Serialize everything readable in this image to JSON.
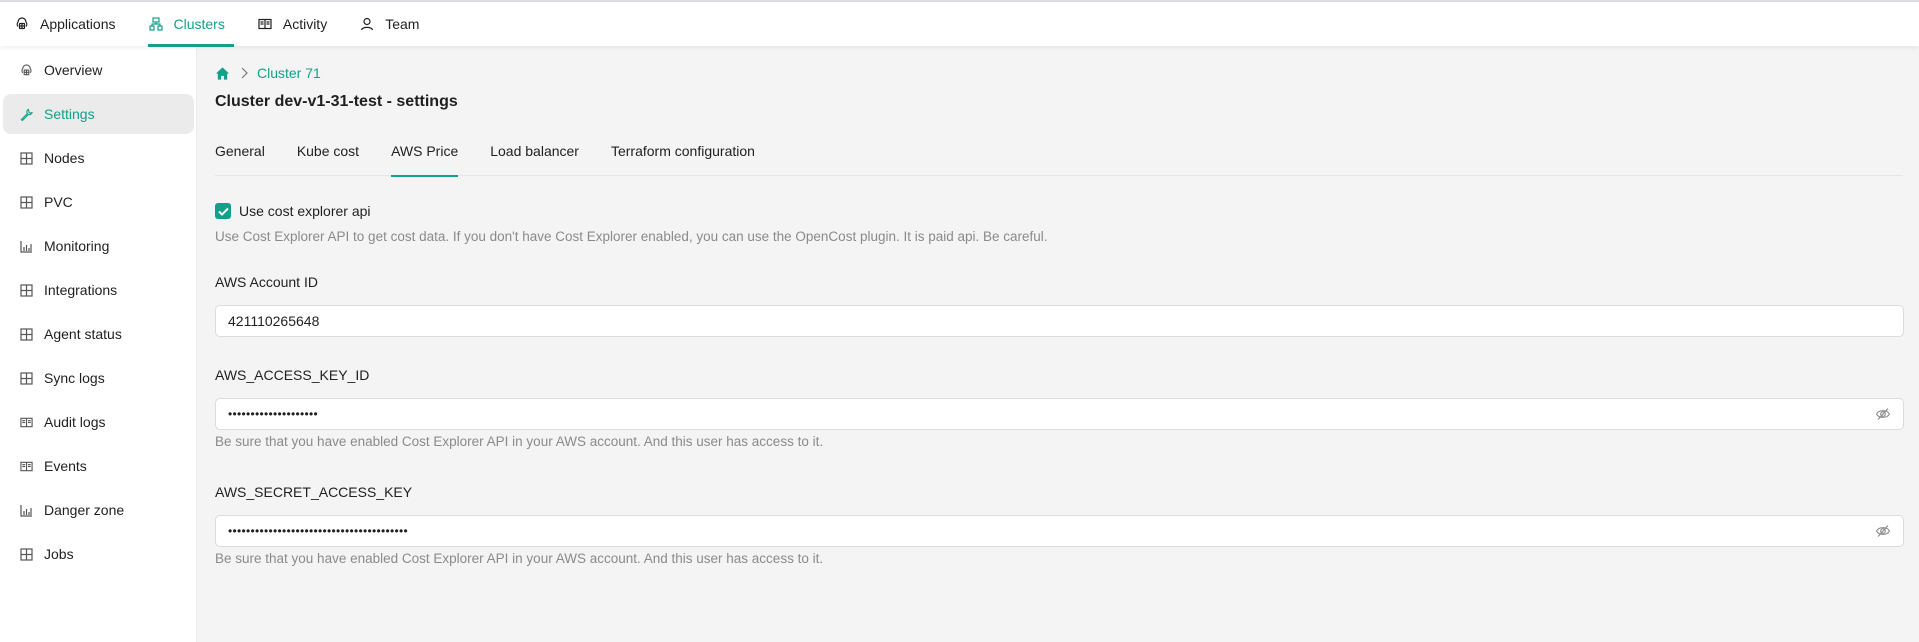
{
  "topnav": {
    "items": [
      {
        "label": "Applications",
        "icon": "cloud-app-icon",
        "active": false
      },
      {
        "label": "Clusters",
        "icon": "cluster-icon",
        "active": true
      },
      {
        "label": "Activity",
        "icon": "book-icon",
        "active": false
      },
      {
        "label": "Team",
        "icon": "user-icon",
        "active": false
      }
    ]
  },
  "sidebar": {
    "items": [
      {
        "label": "Overview",
        "icon": "cloud-app-icon"
      },
      {
        "label": "Settings",
        "icon": "wrench-icon",
        "active": true
      },
      {
        "label": "Nodes",
        "icon": "grid-icon"
      },
      {
        "label": "PVC",
        "icon": "grid-icon"
      },
      {
        "label": "Monitoring",
        "icon": "bar-chart-icon"
      },
      {
        "label": "Integrations",
        "icon": "grid-icon"
      },
      {
        "label": "Agent status",
        "icon": "grid-icon"
      },
      {
        "label": "Sync logs",
        "icon": "grid-icon"
      },
      {
        "label": "Audit logs",
        "icon": "book-icon"
      },
      {
        "label": "Events",
        "icon": "book-icon"
      },
      {
        "label": "Danger zone",
        "icon": "bar-chart-icon"
      },
      {
        "label": "Jobs",
        "icon": "grid-icon"
      }
    ]
  },
  "breadcrumb": {
    "home_icon": "home-icon",
    "separator_icon": "chevron-right-icon",
    "items": [
      "Cluster 71"
    ]
  },
  "page": {
    "title": "Cluster dev-v1-31-test - settings"
  },
  "tabs": [
    {
      "label": "General",
      "active": false
    },
    {
      "label": "Kube cost",
      "active": false
    },
    {
      "label": "AWS Price",
      "active": true
    },
    {
      "label": "Load balancer",
      "active": false
    },
    {
      "label": "Terraform configuration",
      "active": false
    }
  ],
  "form": {
    "use_cost_explorer": {
      "label": "Use cost explorer api",
      "checked": true,
      "help": "Use Cost Explorer API to get cost data. If you don't have Cost Explorer enabled, you can use the OpenCost plugin. It is paid api. Be careful."
    },
    "account_id": {
      "label": "AWS Account ID",
      "value": "421110265648"
    },
    "access_key_id": {
      "label": "AWS_ACCESS_KEY_ID",
      "masked_value": "••••••••••••••••••••",
      "help": "Be sure that you have enabled Cost Explorer API in your AWS account. And this user has access to it.",
      "toggle_icon": "eye-off-icon"
    },
    "secret_access_key": {
      "label": "AWS_SECRET_ACCESS_KEY",
      "masked_value": "••••••••••••••••••••••••••••••••••••••••",
      "help": "Be sure that you have enabled Cost Explorer API in your AWS account. And this user has access to it.",
      "toggle_icon": "eye-off-icon"
    }
  },
  "colors": {
    "accent": "#12a08a",
    "background": "#f4f4f4",
    "help_text": "#8a8a8a"
  }
}
